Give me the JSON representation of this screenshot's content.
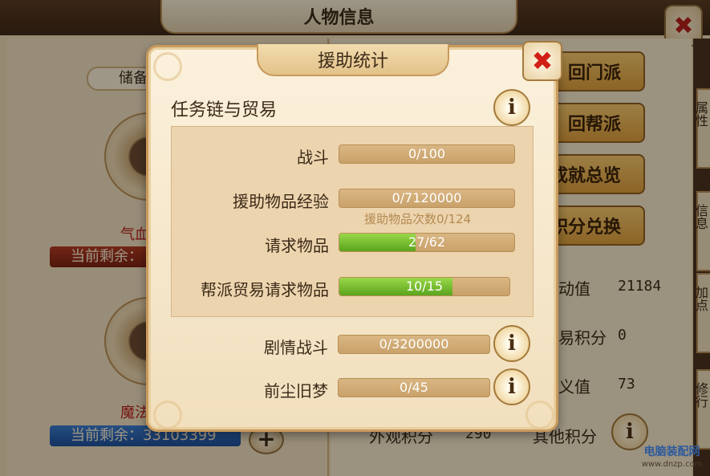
{
  "background": {
    "window_title": "人物信息",
    "close_glyph": "✖",
    "storage_label": "储备",
    "hp_label": "气血",
    "hp_remaining_label": "当前剩余：",
    "mp_label": "魔法",
    "mp_remaining_text": "当前剩余：",
    "mp_remaining_value": "33103399",
    "plus_glyph": "+",
    "buttons": [
      "回门派",
      "回帮派",
      "成就总览",
      "积分兑换"
    ],
    "stats": [
      {
        "label": "动值",
        "value": "21184"
      },
      {
        "label": "易积分",
        "value": "0"
      },
      {
        "label": "义值",
        "value": "73"
      },
      {
        "label": "外观积分",
        "value": "290"
      },
      {
        "label": "其他积分",
        "value": ""
      }
    ],
    "edge_tabs": [
      "属性",
      "信息",
      "加点",
      "修行"
    ]
  },
  "dialog": {
    "title": "援助统计",
    "close_glyph": "✖",
    "section_title": "任务链与贸易",
    "info_glyph": "i",
    "rows": [
      {
        "label": "战斗",
        "text": "0/100",
        "fraction": 0.0
      },
      {
        "label": "援助物品经验",
        "text": "0/7120000",
        "fraction": 0.0
      },
      {
        "label": "请求物品",
        "text": "27/62",
        "fraction": 0.435
      },
      {
        "label": "帮派贸易请求物品",
        "text": "10/15",
        "fraction": 0.6667
      }
    ],
    "sub_note": "援助物品次数0/124",
    "extra_rows": [
      {
        "label": "剧情战斗",
        "text": "0/3200000",
        "fraction": 0.0
      },
      {
        "label": "前尘旧梦",
        "text": "0/45",
        "fraction": 0.0
      }
    ]
  },
  "watermark": {
    "line1": "电脑装配网",
    "line2": "www.dnzp.com"
  },
  "colors": {
    "accent_green": "#6fba26",
    "close_red": "#d02015",
    "button_gold": "#e3ad4e"
  }
}
